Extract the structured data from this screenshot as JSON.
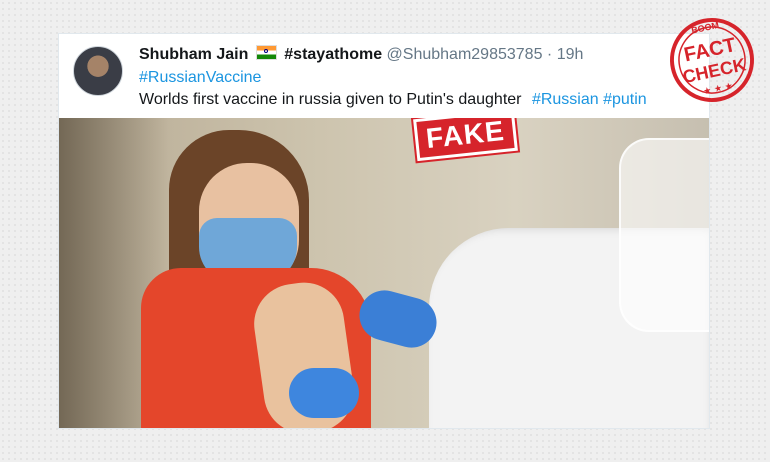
{
  "tweet": {
    "user_name": "Shubham Jain",
    "tag_in_name": "#stayathome",
    "handle": "@Shubham29853785",
    "separator": "·",
    "time": "19h",
    "hashtag_line": "#RussianVaccine",
    "text": "Worlds first vaccine in russia given to Putin's daughter",
    "trailing_hashtags": "#Russian #putin"
  },
  "overlay": {
    "fake_label": "FAKE",
    "badge_top": "BOOM",
    "badge_main_1": "FACT",
    "badge_main_2": "CHECK",
    "badge_stars": "★ ★ ★"
  },
  "colors": {
    "hashtag": "#1b95e0",
    "stamp_red": "#d6242b"
  }
}
